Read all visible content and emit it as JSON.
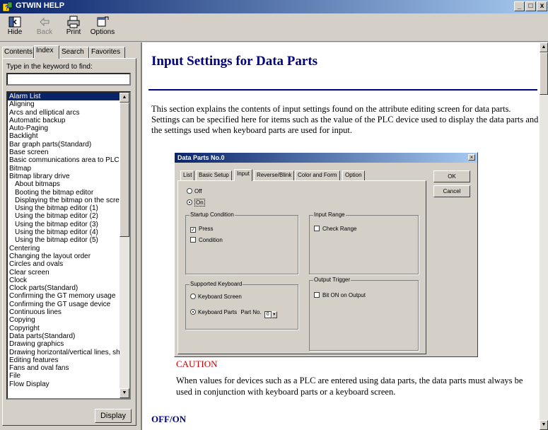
{
  "window": {
    "title": "GTWIN HELP",
    "minimize": "_",
    "maximize": "□",
    "close": "x"
  },
  "toolbar": {
    "hide": "Hide",
    "back": "Back",
    "print": "Print",
    "options": "Options"
  },
  "nav": {
    "tabs": [
      "Contents",
      "Index",
      "Search",
      "Favorites"
    ],
    "active_tab": "Index",
    "keyword_label": "Type in the keyword to find:",
    "keyword_value": "",
    "display_button": "Display",
    "items": [
      "Alarm List",
      "Aligning",
      "Arcs and elliptical arcs",
      "Automatic backup",
      "Auto-Paging",
      "Backlight",
      "Bar graph parts(Standard)",
      "Base screen",
      "Basic communications area to PLC",
      "Bitmap",
      "Bitmap library drive",
      "About bitmaps",
      "Booting the bitmap editor",
      "Displaying the bitmap on the screen",
      "Using the bitmap editor (1)",
      "Using the bitmap editor (2)",
      "Using the bitmap editor (3)",
      "Using the bitmap editor (4)",
      "Using the bitmap editor (5)",
      "Centering",
      "Changing the layout order",
      "Circles and ovals",
      "Clear screen",
      "Clock",
      "Clock parts(Standard)",
      "Confirming the GT memory usage",
      "Confirming the GT usage device",
      "Continuous lines",
      "Copying",
      "Copyright",
      "Data parts(Standard)",
      "Drawing graphics",
      "Drawing horizontal/vertical lines, shapes",
      "Editing features",
      "Fans and oval fans",
      "File",
      "Flow Display"
    ],
    "indented": [
      11,
      12,
      13,
      14,
      15,
      16,
      17,
      18
    ],
    "selected": 0
  },
  "page": {
    "title": "Input Settings for Data Parts",
    "intro": "This section explains the contents of input settings found on the attribute editing screen for data parts. Settings can be specified here for items such as the value of the PLC device used to display the data parts and the settings used when keyboard parts are used for input.",
    "caution_heading": "CAUTION",
    "caution_text": "When values for devices such as a PLC are entered using data parts, the data parts must always be used in conjunction with keyboard parts or a keyboard screen.",
    "next_heading": "OFF/ON"
  },
  "dialog": {
    "title": "Data Parts No.0",
    "close": "×",
    "tabs": [
      "List",
      "Basic Setup",
      "Input",
      "Reverse/Blink",
      "Color and Form",
      "Option"
    ],
    "active_tab": "Input",
    "ok": "OK",
    "cancel": "Cancel",
    "off": "Off",
    "on": "On",
    "startup_condition": "Startup Condition",
    "press": "Press",
    "condition": "Condition",
    "input_range": "Input Range",
    "check_range": "Check Range",
    "supported_keyboard": "Supported Keyboard",
    "keyboard_screen": "Keyboard Screen",
    "keyboard_parts": "Keyboard Parts",
    "part_no_label": "Part No.",
    "part_no_value": "0",
    "output_trigger": "Output Trigger",
    "bit_on_output": "Bit ON on Output"
  }
}
